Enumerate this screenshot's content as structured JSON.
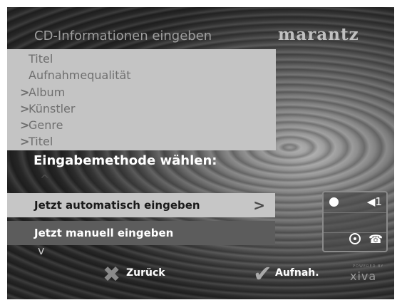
{
  "header": {
    "title": "CD-Informationen eingeben",
    "logo": "marantz"
  },
  "info_items": [
    {
      "arrow": "",
      "label": "Titel"
    },
    {
      "arrow": "",
      "label": "Aufnahmequalität"
    },
    {
      "arrow": ">",
      "label": "Album"
    },
    {
      "arrow": ">",
      "label": "Künstler"
    },
    {
      "arrow": ">",
      "label": "Genre"
    },
    {
      "arrow": ">",
      "label": "Titel"
    }
  ],
  "prompt": "Eingabemethode wählen:",
  "scroll": {
    "up": "^",
    "down": "v"
  },
  "options": [
    {
      "label": "Jetzt automatisch eingeben",
      "selected": true,
      "arrow": ">"
    },
    {
      "label": "Jetzt manuell eingeben",
      "selected": false
    }
  ],
  "status": {
    "record_icon": "record-dot-icon",
    "speaker": "◀1",
    "cd_icon": "cd-icon",
    "phone_icon": "phone-icon",
    "phone": "☎"
  },
  "footer": {
    "back_label": "Zurück",
    "back_icon": "✖",
    "record_label": "Aufnah.",
    "record_icon": "✔",
    "brand": "xiva",
    "brand_sub": "POWERED BY"
  },
  "colors": {
    "accent_panel": "#c4c4c4",
    "selected_row": "#c6c6c6",
    "unselected_row": "#5c5c5c"
  }
}
